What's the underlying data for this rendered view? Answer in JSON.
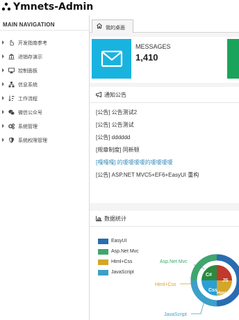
{
  "app": {
    "title": "Ymnets-Admin"
  },
  "sidebar": {
    "heading": "MAIN NAVIGATION",
    "items": [
      {
        "label": "开发指南参考",
        "icon": "pointer-hand-icon"
      },
      {
        "label": "进销存演示",
        "icon": "bank-icon"
      },
      {
        "label": "控制面板",
        "icon": "desktop-icon"
      },
      {
        "label": "信息系统",
        "icon": "sitemap-icon"
      },
      {
        "label": "工作流程",
        "icon": "sort-list-icon"
      },
      {
        "label": "微信公众号",
        "icon": "wechat-icon"
      },
      {
        "label": "系统管理",
        "icon": "gears-icon"
      },
      {
        "label": "系统权限管理",
        "icon": "shield-icon"
      }
    ]
  },
  "tabs": [
    {
      "label": "我的桌面",
      "icon": "home-icon"
    }
  ],
  "stats": {
    "label": "MESSAGES",
    "value": "1,410",
    "icon": "envelope-icon",
    "color": "#19b3e0",
    "next_color": "#1aa35a"
  },
  "notices": {
    "title": "通知公告",
    "items": [
      {
        "text": "[公告] 公告测试2"
      },
      {
        "text": "[公告] 公告测试"
      },
      {
        "text": "[公告] dddddd"
      },
      {
        "text": "[规章制度] 同新顿"
      },
      {
        "text": "[嘎嘎嘎] 的嗄嗄嗄嗄的嗄嗄嗄嗄",
        "link": true
      },
      {
        "text": "[公告] ASP.NET MVC5+EF6+EasyUI 重构"
      }
    ]
  },
  "stats_panel": {
    "title": "数据统计"
  },
  "chart_data": {
    "type": "pie",
    "title": "",
    "legend_position": "left",
    "series": [
      {
        "name": "EasyUI",
        "color": "#2a6cb2"
      },
      {
        "name": "Asp.Net Mvc",
        "color": "#3fa66e"
      },
      {
        "name": "Html+Css",
        "color": "#d4a62a"
      },
      {
        "name": "JavaScript",
        "color": "#3ca0c8"
      }
    ],
    "inner_labels": [
      "C#",
      "JS",
      "Css",
      "Html"
    ],
    "callout_labels": [
      "Asp.Net Mvc",
      "Html+Css",
      "JavaScript"
    ]
  }
}
